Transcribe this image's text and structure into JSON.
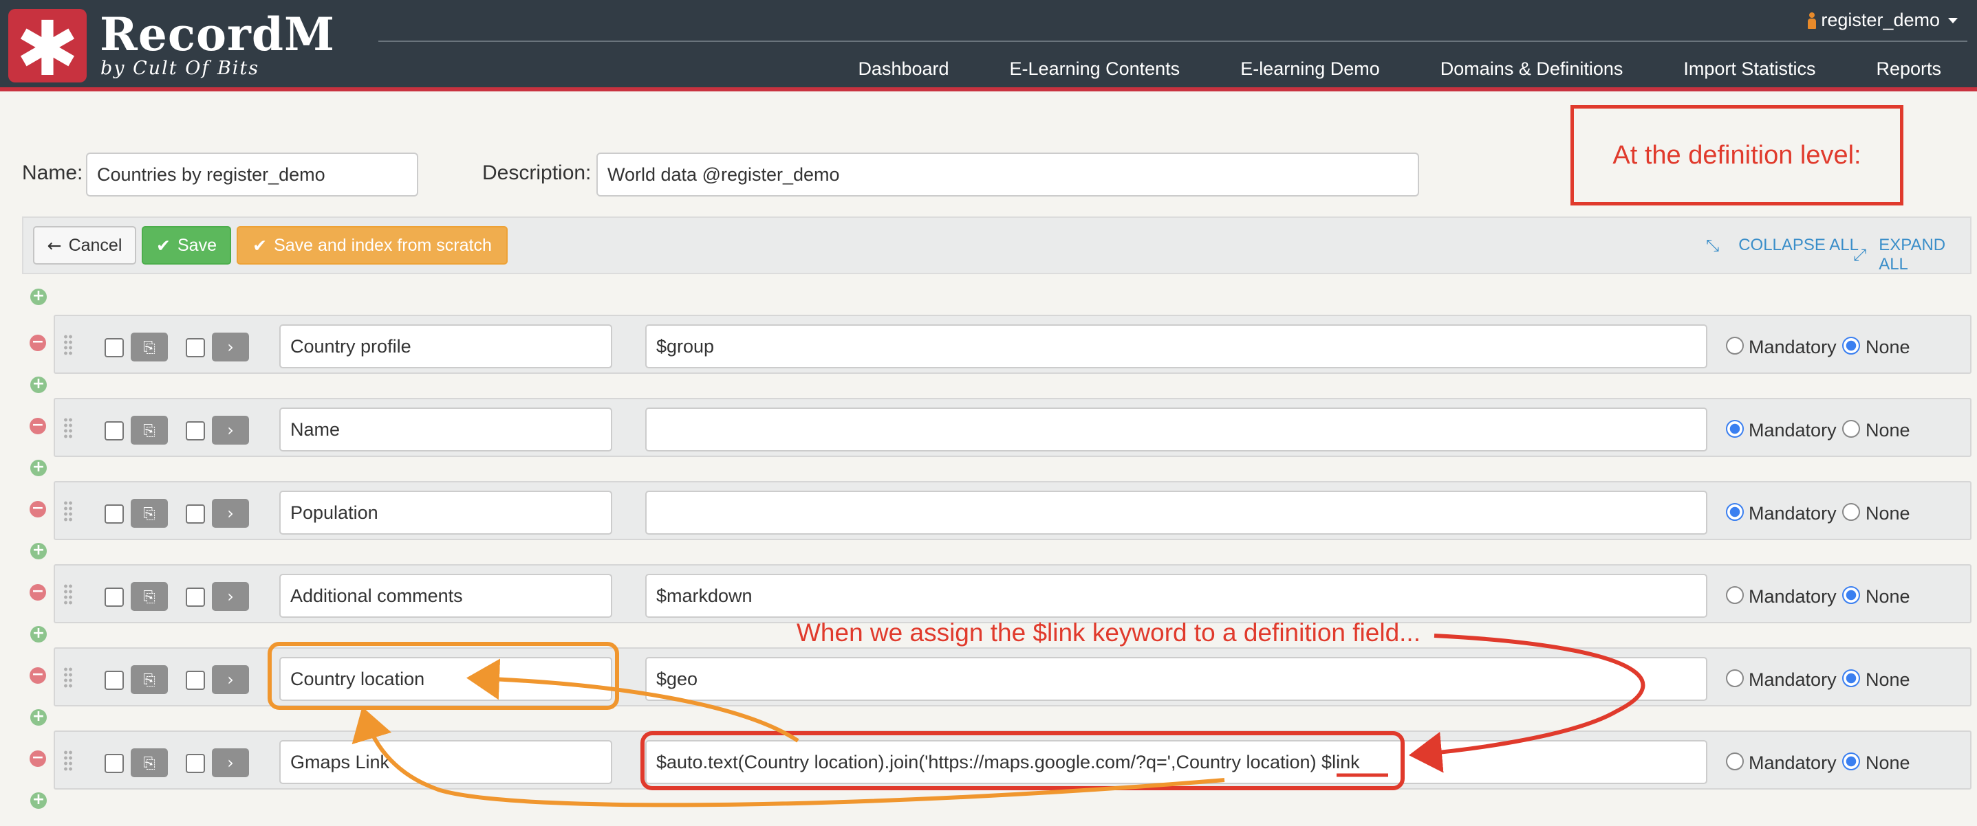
{
  "app": {
    "brand": "RecordM",
    "brand_sub": "by Cult Of Bits",
    "logo_icon": "asterisk-icon",
    "colors": {
      "header": "#323c45",
      "brand_red": "#c8323f",
      "annotation_red": "#e03a2c",
      "annotation_orange": "#f0962e"
    }
  },
  "header": {
    "user": "register_demo",
    "nav": [
      "Dashboard",
      "E-Learning Contents",
      "E-learning Demo",
      "Domains & Definitions",
      "Import Statistics",
      "Reports"
    ]
  },
  "form": {
    "name_label": "Name:",
    "name_value": "Countries by register_demo",
    "description_label": "Description:",
    "description_value": "World data @register_demo"
  },
  "toolbar": {
    "cancel": "Cancel",
    "save": "Save",
    "save_index": "Save and index from scratch",
    "collapse_all": "COLLAPSE ALL",
    "expand_all": "EXPAND ALL"
  },
  "radio_labels": {
    "mandatory": "Mandatory",
    "none": "None"
  },
  "fields": [
    {
      "name": "Country profile",
      "description": "$group",
      "mandatory": false
    },
    {
      "name": "Name",
      "description": "",
      "mandatory": true
    },
    {
      "name": "Population",
      "description": "",
      "mandatory": true
    },
    {
      "name": "Additional comments",
      "description": "$markdown",
      "mandatory": false
    },
    {
      "name": "Country location",
      "description": "$geo",
      "mandatory": false
    },
    {
      "name": "Gmaps Link",
      "description": "$auto.text(Country location).join('https://maps.google.com/?q=',Country location) $link",
      "mandatory": false
    }
  ],
  "annotations": {
    "box_note": "At the definition level:",
    "arrow_note": "When we assign the $link keyword to a definition field..."
  }
}
